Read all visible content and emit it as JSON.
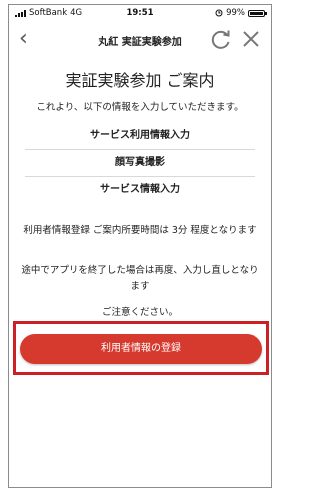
{
  "status": {
    "carrier": "SoftBank",
    "network": "4G",
    "time": "19:51",
    "battery": "99%",
    "battery_level": 0.99
  },
  "nav": {
    "back_icon": "chevron-left-icon",
    "title": "丸紅 実証実験参加",
    "reload_icon": "reload-icon",
    "close_icon": "close-icon"
  },
  "main": {
    "heading": "実証実験参加 ご案内",
    "intro": "これより、以下の情報を入力していただきます。",
    "items": [
      {
        "label": "サービス利用情報入力"
      },
      {
        "label": "顔写真撮影"
      },
      {
        "label": "サービス情報入力"
      }
    ],
    "time_note": "利用者情報登録 ご案内所要時間は 3分 程度となります",
    "resume_note": "途中でアプリを終了した場合は再度、入力し直しとなります",
    "caution": "ご注意ください。",
    "register_button": "利用者情報の登録"
  },
  "colors": {
    "accent": "#d63a2f",
    "outline": "#cc2027"
  }
}
